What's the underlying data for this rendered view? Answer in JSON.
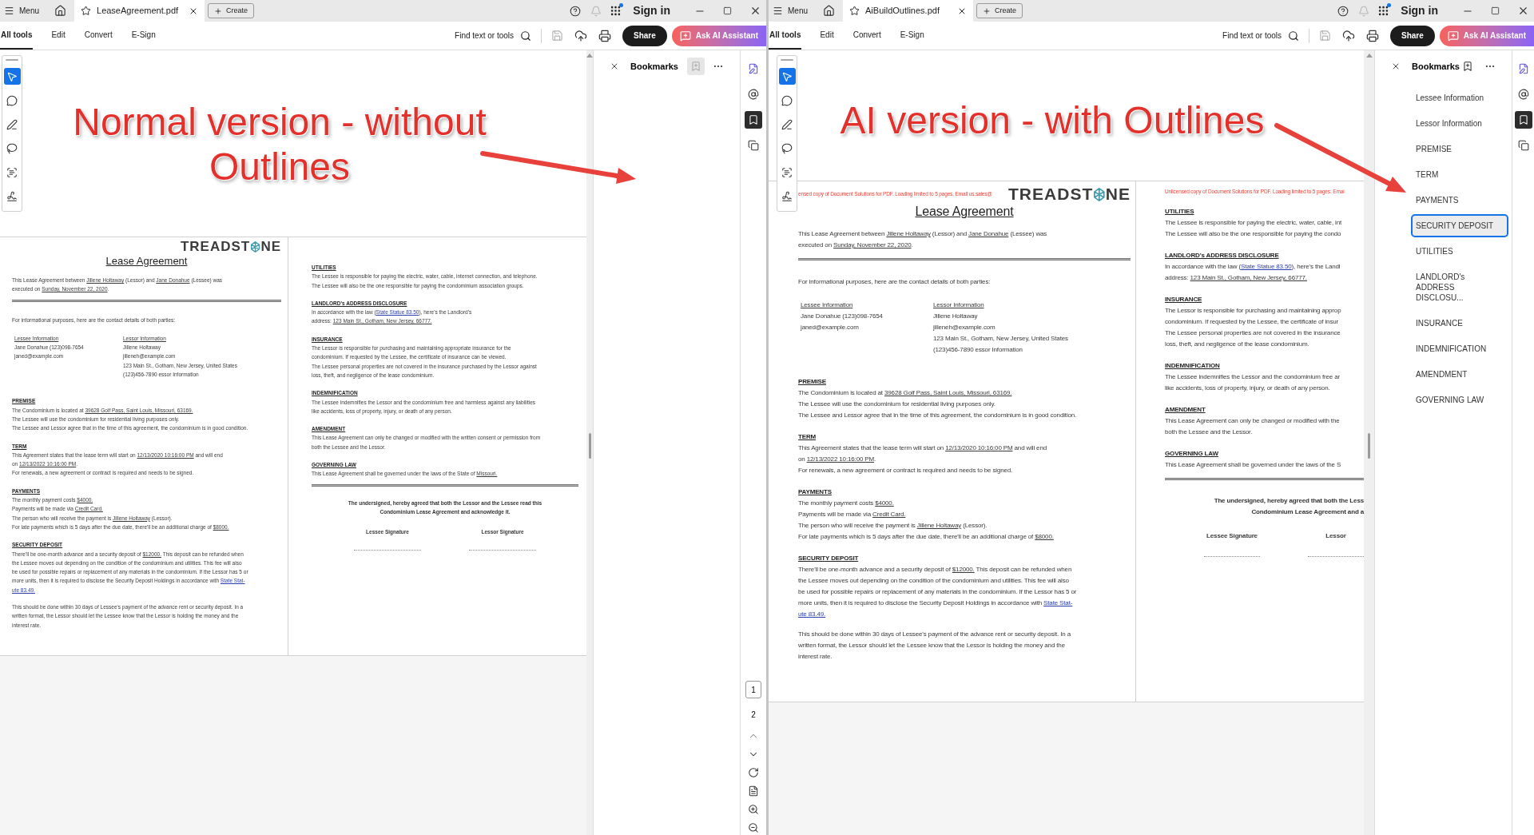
{
  "windows": [
    {
      "menu": "Menu",
      "tab": {
        "title": "LeaseAgreement.pdf"
      },
      "create": "Create",
      "sign_in": "Sign in",
      "tool_tabs": [
        {
          "label": "All tools",
          "selected": true
        },
        {
          "label": "Edit",
          "selected": false
        },
        {
          "label": "Convert",
          "selected": false
        },
        {
          "label": "E-Sign",
          "selected": false
        }
      ],
      "find": "Find text or tools",
      "share": "Share",
      "ask_ai": "Ask AI Assistant",
      "tools": [
        {
          "kind": "pointer",
          "selected": true
        },
        {
          "kind": "comment",
          "selected": false
        },
        {
          "kind": "draw",
          "selected": false
        },
        {
          "kind": "lasso",
          "selected": false
        },
        {
          "kind": "textselect",
          "selected": false
        },
        {
          "kind": "sign",
          "selected": false
        }
      ],
      "annotation": {
        "text": "Normal version - without Outlines"
      },
      "document": {
        "pages": [
          {
            "blocks": [
              {
                "kind": "header",
                "logo": {
                  "before": "TREADST",
                  "after": "NE"
                }
              },
              {
                "kind": "title",
                "text": "Lease Agreement"
              },
              {
                "kind": "paragraph",
                "lines": [
                  [
                    "This Lease Agreement between ",
                    {
                      "kind": "underline",
                      "text": "Jillene Holtaway"
                    },
                    " (Lessor) and ",
                    {
                      "kind": "underline",
                      "text": "Jane Donahue"
                    },
                    " (Lessee) was"
                  ],
                  [
                    "executed on ",
                    {
                      "kind": "underline",
                      "text": "Sunday, November 22, 2020"
                    },
                    "."
                  ]
                ]
              },
              {
                "kind": "rule"
              },
              {
                "kind": "paragraph",
                "lines": [
                  [
                    "For informational purposes, here are the contact details of both parties:"
                  ]
                ]
              },
              {
                "kind": "contacts",
                "columns": [
                  {
                    "heading": "Lessee Information",
                    "lines": [
                      "Jane Donahue (123)098-7654",
                      "janed@example.com"
                    ]
                  },
                  {
                    "heading": "Lessor Information",
                    "lines": [
                      "Jillene Holtaway",
                      "jilleneh@example.com",
                      "123 Main St., Gotham, New Jersey, United States",
                      "(123)456-7890 essor Information"
                    ]
                  }
                ]
              },
              {
                "kind": "section",
                "heading": "PREMISE",
                "lines": [
                  [
                    "The Condominium is located at ",
                    {
                      "kind": "underline",
                      "text": "39628 Golf Pass, Saint Louis, Missouri, 63169."
                    }
                  ],
                  [
                    "The Lessee will use the condominium for residential living purposes only."
                  ],
                  [
                    "The Lessee and Lessor agree that in the time of this agreement, the condominium is in good condition."
                  ]
                ]
              },
              {
                "kind": "section",
                "heading": "TERM",
                "lines": [
                  [
                    "This Agreement states that the lease term will start on ",
                    {
                      "kind": "underline",
                      "text": "12/13/2020 10:16:00 PM"
                    },
                    " and will end"
                  ],
                  [
                    "on ",
                    {
                      "kind": "underline",
                      "text": "12/13/2022 10:16:00 PM"
                    },
                    "."
                  ],
                  [
                    "For renewals, a new agreement or contract is required and needs to be signed."
                  ]
                ]
              },
              {
                "kind": "section",
                "heading": "PAYMENTS",
                "lines": [
                  [
                    "The monthly payment costs ",
                    {
                      "kind": "underline",
                      "text": "$4000."
                    }
                  ],
                  [
                    "Payments will be made via ",
                    {
                      "kind": "underline",
                      "text": "Credit Card."
                    }
                  ],
                  [
                    "The person who will receive the payment is ",
                    {
                      "kind": "underline",
                      "text": "Jillene Holtaway"
                    },
                    " (Lessor)."
                  ],
                  [
                    "For late payments which is 5 days after the due date, there'll be an additional charge of ",
                    {
                      "kind": "underline",
                      "text": "$8000."
                    }
                  ]
                ]
              },
              {
                "kind": "section",
                "heading": "SECURITY DEPOSIT",
                "lines": [
                  [
                    "There'll be one-month advance and a security deposit of ",
                    {
                      "kind": "underline",
                      "text": "$12000."
                    },
                    " This deposit can be refunded when"
                  ],
                  [
                    "the Lessee moves out depending on the condition of the condominium and utilities. This fee will also"
                  ],
                  [
                    "be used for possible repairs or replacement of any materials in the condominium. If the Lessor has 5 or"
                  ],
                  [
                    "more units, then it is required to disclose the Security Deposit Holdings in accordance with ",
                    {
                      "kind": "link",
                      "text": "State Stat-"
                    }
                  ],
                  [
                    {
                      "kind": "link",
                      "text": "ute 83.49."
                    }
                  ]
                ]
              },
              {
                "kind": "paragraph",
                "lines": [
                  [
                    "This should be done within 30 days of Lessee's payment of the advance rent or security deposit. In a"
                  ],
                  [
                    "written format, the Lessor should let the Lessee know that the Lessor is holding the money and the"
                  ],
                  [
                    "interest rate."
                  ]
                ]
              }
            ]
          },
          {
            "blocks": [
              {
                "kind": "section",
                "heading": "UTILITIES",
                "lines": [
                  [
                    "The Lessee is responsible for paying the electric, water, cable, internet connection, and telephone."
                  ],
                  [
                    "The Lessee will also be the one responsible for paying the condominium association groups."
                  ]
                ]
              },
              {
                "kind": "section",
                "heading": "LANDLORD's ADDRESS DISCLOSURE",
                "lines": [
                  [
                    "In accordance with the law (",
                    {
                      "kind": "link",
                      "text": "State Statue 83.50"
                    },
                    "), here's the Landlord's"
                  ],
                  [
                    "address: ",
                    {
                      "kind": "underline",
                      "text": "123 Main St., Gotham, New Jersey, 66777."
                    }
                  ]
                ]
              },
              {
                "kind": "section",
                "heading": "INSURANCE",
                "lines": [
                  [
                    "The Lessor is responsible for purchasing and maintaining appropriate insurance for the"
                  ],
                  [
                    "condominium. If requested by the Lessee, the certificate of insurance can be viewed."
                  ],
                  [
                    "The Lessee personal properties are not covered in the insurance purchased by the Lessor against"
                  ],
                  [
                    "loss, theft, and negligence of the lease condominium."
                  ]
                ]
              },
              {
                "kind": "section",
                "heading": "INDEMNIFICATION",
                "lines": [
                  [
                    "The Lessee indemnifies the Lessor and the condominium free and harmless against any liabilities"
                  ],
                  [
                    "like accidents, loss of property, injury, or death of any person."
                  ]
                ]
              },
              {
                "kind": "section",
                "heading": "AMENDMENT",
                "lines": [
                  [
                    "This Lease Agreement can only be changed or modified with the written consent or permission from"
                  ],
                  [
                    "both the Lessee and the Lessor."
                  ]
                ]
              },
              {
                "kind": "section",
                "heading": "GOVERNING LAW",
                "lines": [
                  [
                    "This Lease Agreement shall be governed under the laws of the State of ",
                    {
                      "kind": "underline",
                      "text": "Missouri."
                    }
                  ]
                ]
              },
              {
                "kind": "rule"
              },
              {
                "kind": "signatures",
                "statement": [
                  "The undersigned, hereby agreed that both the Lessor and the Lessee read this",
                  "Condominium Lease Agreement and acknowledge it."
                ],
                "labels": [
                  "Lessee Signature",
                  "Lessor Signature"
                ]
              }
            ]
          }
        ]
      },
      "bookmarks_panel": {
        "title": "Bookmarks",
        "add_disabled": true
      },
      "rail": [
        {
          "kind": "ai",
          "selected": false
        },
        {
          "kind": "comment",
          "selected": false
        },
        {
          "kind": "bookmarks",
          "selected": true
        },
        {
          "kind": "pages",
          "selected": false
        }
      ],
      "page_nav": {
        "pages": [
          {
            "label": "1",
            "selected": true
          },
          {
            "label": "2",
            "selected": false
          }
        ]
      }
    },
    {
      "menu": "Menu",
      "tab": {
        "title": "AiBuildOutlines.pdf"
      },
      "create": "Create",
      "sign_in": "Sign in",
      "tool_tabs": [
        {
          "label": "All tools",
          "selected": true
        },
        {
          "label": "Edit",
          "selected": false
        },
        {
          "label": "Convert",
          "selected": false
        },
        {
          "label": "E-Sign",
          "selected": false
        }
      ],
      "find": "Find text or tools",
      "share": "Share",
      "ask_ai": "Ask AI Assistant",
      "tools": [
        {
          "kind": "pointer",
          "selected": true
        },
        {
          "kind": "comment",
          "selected": false
        },
        {
          "kind": "draw",
          "selected": false
        },
        {
          "kind": "lasso",
          "selected": false
        },
        {
          "kind": "textselect",
          "selected": false
        },
        {
          "kind": "sign",
          "selected": false
        }
      ],
      "annotation": {
        "text": "AI version - with Outlines"
      },
      "document": {
        "pages": [
          {
            "blocks": [
              {
                "kind": "header",
                "notice": "ensed copy of Document Solutions for PDF. Loading limited to 5 pages. Email us.sales@",
                "logo": {
                  "before": "TREADST",
                  "after": "NE"
                }
              },
              {
                "kind": "title",
                "text": "Lease Agreement"
              },
              {
                "kind": "paragraph",
                "lines": [
                  [
                    "This Lease Agreement between ",
                    {
                      "kind": "underline",
                      "text": "Jillene Holtaway"
                    },
                    " (Lessor) and ",
                    {
                      "kind": "underline",
                      "text": "Jane Donahue"
                    },
                    " (Lessee) was"
                  ],
                  [
                    "executed on ",
                    {
                      "kind": "underline",
                      "text": "Sunday, November 22, 2020"
                    },
                    "."
                  ]
                ]
              },
              {
                "kind": "rule"
              },
              {
                "kind": "paragraph",
                "lines": [
                  [
                    "For informational purposes, here are the contact details of both parties:"
                  ]
                ]
              },
              {
                "kind": "contacts",
                "columns": [
                  {
                    "heading": "Lessee Information",
                    "lines": [
                      "Jane Donahue (123)098-7654",
                      "janed@example.com"
                    ]
                  },
                  {
                    "heading": "Lessor Information",
                    "lines": [
                      "Jillene Holtaway",
                      "jilleneh@example.com",
                      "123 Main St., Gotham, New Jersey, United States",
                      "(123)456-7890 essor Information"
                    ]
                  }
                ]
              },
              {
                "kind": "section",
                "heading": "PREMISE",
                "lines": [
                  [
                    "The Condominium is located at ",
                    {
                      "kind": "underline",
                      "text": "39628 Golf Pass, Saint Louis, Missouri, 63169."
                    }
                  ],
                  [
                    "The Lessee will use the condominium for residential living purposes only."
                  ],
                  [
                    "The Lessee and Lessor agree that in the time of this agreement, the condominium is in good condition."
                  ]
                ]
              },
              {
                "kind": "section",
                "heading": "TERM",
                "lines": [
                  [
                    "This Agreement states that the lease term will start on ",
                    {
                      "kind": "underline",
                      "text": "12/13/2020 10:16:00 PM"
                    },
                    " and will end"
                  ],
                  [
                    "on ",
                    {
                      "kind": "underline",
                      "text": "12/13/2022 10:16:00 PM"
                    },
                    "."
                  ],
                  [
                    "For renewals, a new agreement or contract is required and needs to be signed."
                  ]
                ]
              },
              {
                "kind": "section",
                "heading": "PAYMENTS",
                "lines": [
                  [
                    "The monthly payment costs ",
                    {
                      "kind": "underline",
                      "text": "$4000."
                    }
                  ],
                  [
                    "Payments will be made via ",
                    {
                      "kind": "underline",
                      "text": "Credit Card."
                    }
                  ],
                  [
                    "The person who will receive the payment is ",
                    {
                      "kind": "underline",
                      "text": "Jillene Holtaway"
                    },
                    " (Lessor)."
                  ],
                  [
                    "For late payments which is 5 days after the due date, there'll be an additional charge of ",
                    {
                      "kind": "underline",
                      "text": "$8000."
                    }
                  ]
                ]
              },
              {
                "kind": "section",
                "heading": "SECURITY DEPOSIT",
                "lines": [
                  [
                    "There'll be one-month advance and a security deposit of ",
                    {
                      "kind": "underline",
                      "text": "$12000."
                    },
                    " This deposit can be refunded when"
                  ],
                  [
                    "the Lessee moves out depending on the condition of the condominium and utilities. This fee will also"
                  ],
                  [
                    "be used for possible repairs or replacement of any materials in the condominium. If the Lessor has 5 or"
                  ],
                  [
                    "more units, then it is required to disclose the Security Deposit Holdings in accordance with ",
                    {
                      "kind": "link",
                      "text": "State Stat-"
                    }
                  ],
                  [
                    {
                      "kind": "link",
                      "text": "ute 83.49."
                    }
                  ]
                ]
              },
              {
                "kind": "paragraph",
                "lines": [
                  [
                    "This should be done within 30 days of Lessee's payment of the advance rent or security deposit. In a"
                  ],
                  [
                    "written format, the Lessor should let the Lessee know that the Lessor is holding the money and the"
                  ],
                  [
                    "interest rate."
                  ]
                ]
              }
            ]
          },
          {
            "blocks": [
              {
                "kind": "notice",
                "text": "Unlicensed copy of Document Solutions for PDF. Loading limited to 5 pages. Emai"
              },
              {
                "kind": "section",
                "heading": "UTILITIES",
                "lines": [
                  [
                    "The Lessee is responsible for paying the electric, water, cable, int"
                  ],
                  [
                    "The Lessee will also be the one responsible for paying the condo"
                  ]
                ]
              },
              {
                "kind": "section",
                "heading": "LANDLORD's ADDRESS DISCLOSURE",
                "lines": [
                  [
                    "In accordance with the law (",
                    {
                      "kind": "link",
                      "text": "State Statue 83.50"
                    },
                    "), here's the Landl"
                  ],
                  [
                    "address: ",
                    {
                      "kind": "underline",
                      "text": "123 Main St., Gotham, New Jersey, 66777."
                    }
                  ]
                ]
              },
              {
                "kind": "section",
                "heading": "INSURANCE",
                "lines": [
                  [
                    "The Lessor is responsible for purchasing and maintaining approp"
                  ],
                  [
                    "condominium. If requested by the Lessee, the certificate of insur"
                  ],
                  [
                    "The Lessee personal properties are not covered in the insurance"
                  ],
                  [
                    "loss, theft, and negligence of the lease condominium."
                  ]
                ]
              },
              {
                "kind": "section",
                "heading": "INDEMNIFICATION",
                "lines": [
                  [
                    "The Lessee indemnifies the Lessor and the condominium free ar"
                  ],
                  [
                    "like accidents, loss of property, injury, or death of any person."
                  ]
                ]
              },
              {
                "kind": "section",
                "heading": "AMENDMENT",
                "lines": [
                  [
                    "This Lease Agreement can only be changed or modified with the"
                  ],
                  [
                    "both the Lessee and the Lessor."
                  ]
                ]
              },
              {
                "kind": "section",
                "heading": "GOVERNING LAW",
                "lines": [
                  [
                    "This Lease Agreement shall be governed under the laws of the S"
                  ]
                ]
              },
              {
                "kind": "rule"
              },
              {
                "kind": "signatures",
                "statement": [
                  "The undersigned, hereby agreed that both the Less",
                  "Condominium Lease Agreement and a"
                ],
                "labels": [
                  "Lessee Signature",
                  "Lessor"
                ]
              }
            ]
          }
        ]
      },
      "bookmarks_panel": {
        "title": "Bookmarks",
        "add_disabled": false,
        "items": [
          {
            "label": "Lessee Information",
            "selected": false
          },
          {
            "label": "Lessor Information",
            "selected": false
          },
          {
            "label": "PREMISE",
            "selected": false
          },
          {
            "label": "TERM",
            "selected": false
          },
          {
            "label": "PAYMENTS",
            "selected": false
          },
          {
            "label": "SECURITY DEPOSIT",
            "selected": true
          },
          {
            "label": "UTILITIES",
            "selected": false
          },
          {
            "label": "LANDLORD's ADDRESS DISCLOSU...",
            "selected": false
          },
          {
            "label": "INSURANCE",
            "selected": false
          },
          {
            "label": "INDEMNIFICATION",
            "selected": false
          },
          {
            "label": "AMENDMENT",
            "selected": false
          },
          {
            "label": "GOVERNING LAW",
            "selected": false
          }
        ]
      },
      "rail": [
        {
          "kind": "ai",
          "selected": false
        },
        {
          "kind": "comment",
          "selected": false
        },
        {
          "kind": "bookmarks",
          "selected": true
        },
        {
          "kind": "pages",
          "selected": false
        }
      ]
    }
  ]
}
